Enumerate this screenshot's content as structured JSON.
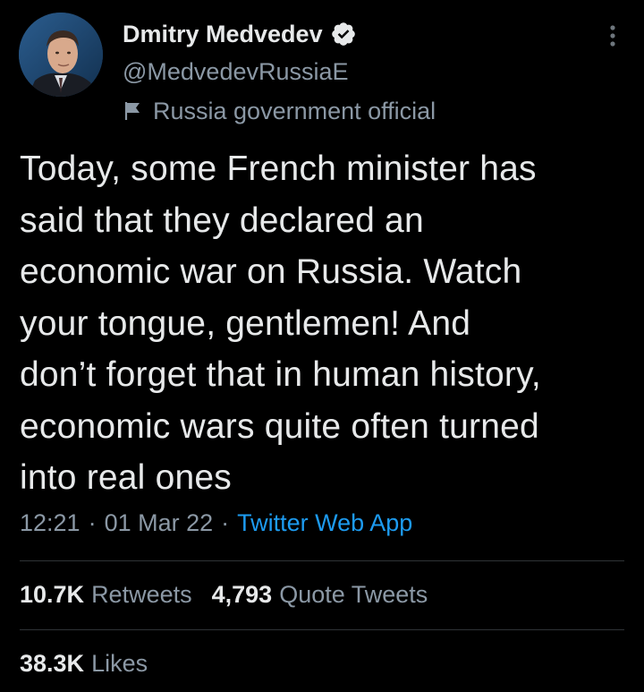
{
  "author": {
    "display_name": "Dmitry Medvedev",
    "handle": "@MedvedevRussiaE",
    "label": "Russia government official",
    "verified": true,
    "avatar_icon": "profile-photo",
    "verified_icon": "verified-badge-icon",
    "label_icon": "flag-icon"
  },
  "tweet": {
    "lines": [
      "Today, some French minister has",
      "said that they declared an",
      "economic war on Russia. Watch",
      "your tongue, gentlemen! And",
      "don’t forget that in human history,",
      "economic wars quite often turned",
      "into real ones"
    ],
    "time": "12:21",
    "separator": "·",
    "date": "01 Mar 22",
    "source": "Twitter Web App"
  },
  "stats": {
    "retweets": {
      "count": "10.7K",
      "label": "Retweets"
    },
    "quotes": {
      "count": "4,793",
      "label": "Quote Tweets"
    },
    "likes": {
      "count": "38.3K",
      "label": "Likes"
    }
  },
  "colors": {
    "background": "#000000",
    "text_primary": "#e7e9ea",
    "text_secondary": "#8b98a5",
    "link": "#1d9bf0",
    "divider": "#2f3336"
  }
}
